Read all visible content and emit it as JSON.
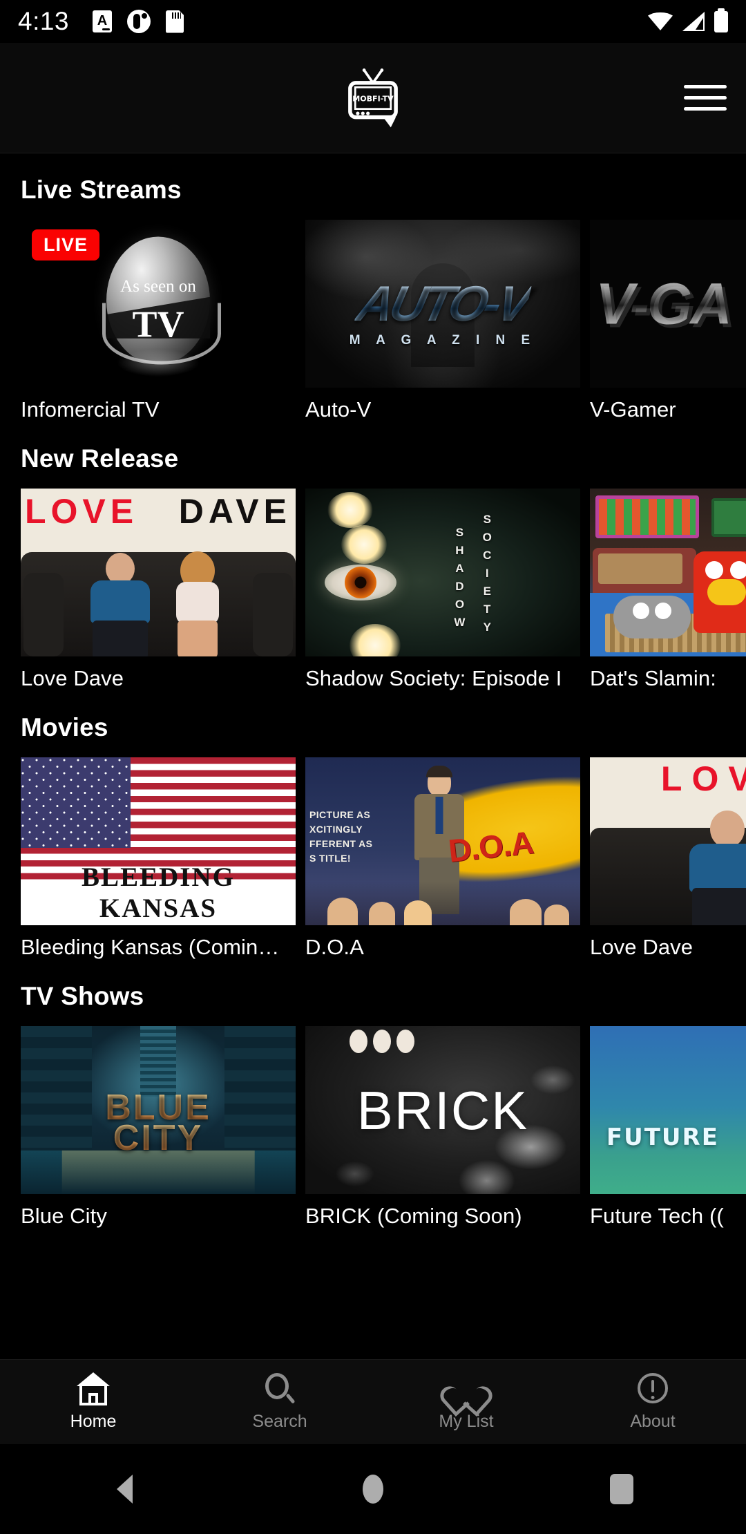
{
  "status_bar": {
    "time": "4:13",
    "left_icons": [
      "document-a-icon",
      "app-circle-icon",
      "sd-card-icon"
    ],
    "right_icons": [
      "wifi-icon",
      "cellular-signal-icon",
      "battery-icon"
    ]
  },
  "header": {
    "logo_text": "MOBFI-TV",
    "logo_name": "mobfi-tv-logo",
    "menu_name": "hamburger-menu"
  },
  "sections": [
    {
      "title": "Live Streams",
      "cards": [
        {
          "title": "Infomercial TV",
          "badge": "LIVE",
          "art": "as-seen-on-tv-sphere",
          "art_text_1": "As seen on",
          "art_text_2": "TV"
        },
        {
          "title": "Auto-V",
          "badge": "",
          "art": "auto-v-magazine-logo",
          "art_text_1": "AUTO-V",
          "art_text_2": "M A G A Z I N E"
        },
        {
          "title": "V-Gamer",
          "badge": "",
          "art": "v-gamer-chrome-logo",
          "art_text_1": "V-GA",
          "art_text_2": ""
        }
      ]
    },
    {
      "title": "New Release",
      "cards": [
        {
          "title": "Love Dave",
          "badge": "",
          "art": "love-dave-poster",
          "art_text_1": "LOVE",
          "art_text_2": "DAVE"
        },
        {
          "title": "Shadow Society: Episode I",
          "badge": "",
          "art": "shadow-society-eye-poster",
          "art_text_1": "SHADOW",
          "art_text_2": "SOCIETY"
        },
        {
          "title": "Dat's Slamin:",
          "badge": "",
          "art": "dats-slamin-diner-photo",
          "art_text_1": "",
          "art_text_2": ""
        }
      ]
    },
    {
      "title": "Movies",
      "cards": [
        {
          "title": "Bleeding Kansas (Comin…",
          "badge": "",
          "art": "bleeding-kansas-flag-poster",
          "art_text_1": "BLEEDING KANSAS",
          "art_text_2": ""
        },
        {
          "title": "D.O.A",
          "badge": "",
          "art": "doa-noir-poster",
          "art_text_1": "D.O.A",
          "art_text_2": "PICTURE AS\nXCITINGLY\nFFERENT AS\nS TITLE!"
        },
        {
          "title": "Love Dave",
          "badge": "",
          "art": "love-dave-poster-portrait",
          "art_text_1": "LOVE",
          "art_text_2": ""
        }
      ]
    },
    {
      "title": "TV Shows",
      "cards": [
        {
          "title": "Blue City",
          "badge": "",
          "art": "blue-city-alley-poster",
          "art_text_1": "BLUE",
          "art_text_2": "CITY"
        },
        {
          "title": "BRICK (Coming Soon)",
          "badge": "",
          "art": "brick-powder-poster",
          "art_text_1": "BRICK",
          "art_text_2": ""
        },
        {
          "title": "Future Tech ((",
          "badge": "",
          "art": "future-tech-circuit-poster",
          "art_text_1": "FUTURE",
          "art_text_2": ""
        }
      ]
    }
  ],
  "tab_bar": {
    "tabs": [
      {
        "label": "Home",
        "icon": "home-icon",
        "active": true
      },
      {
        "label": "Search",
        "icon": "search-icon",
        "active": false
      },
      {
        "label": "My List",
        "icon": "heart-icon",
        "active": false
      },
      {
        "label": "About",
        "icon": "info-exclamation-icon",
        "active": false
      }
    ]
  },
  "android_nav": {
    "back": "back-triangle-icon",
    "home": "home-circle-icon",
    "recents": "recents-square-icon"
  },
  "colors": {
    "background": "#000000",
    "live_badge": "#fa0202",
    "text_primary": "#ffffff",
    "text_muted": "#8c8c8c"
  }
}
